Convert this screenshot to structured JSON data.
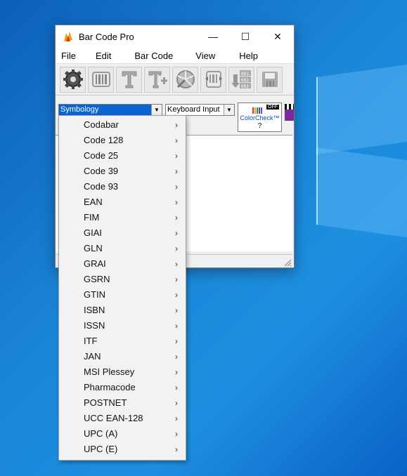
{
  "window": {
    "title": "Bar Code Pro",
    "minimize_glyph": "—",
    "maximize_glyph": "☐",
    "close_glyph": "✕"
  },
  "menu": [
    "File",
    "Edit",
    "Bar Code",
    "View",
    "Help"
  ],
  "toolbar": {
    "icons": [
      "gear-icon",
      "barcode-icon",
      "text-icon",
      "text-add-icon",
      "color-wheel-icon",
      "scale-icon",
      "sequence-icon",
      "save-icon"
    ]
  },
  "controls": {
    "symbology_value": "Symbology",
    "input_value": "Keyboard Input",
    "colorcheck_badge": "OFF",
    "colorcheck_label": "ColorCheck™",
    "colorcheck_help": "?"
  },
  "dropdown": {
    "items": [
      "Codabar",
      "Code 128",
      "Code 25",
      "Code 39",
      "Code 93",
      "EAN",
      "FIM",
      "GIAI",
      "GLN",
      "GRAI",
      "GSRN",
      "GTIN",
      "ISBN",
      "ISSN",
      "ITF",
      "JAN",
      "MSI Plessey",
      "Pharmacode",
      "POSTNET",
      "UCC EAN-128",
      "UPC (A)",
      "UPC (E)"
    ],
    "chevron": "›"
  },
  "colors": {
    "symbology_highlight": "#0a64d2",
    "desktop": "#1a86d8"
  }
}
